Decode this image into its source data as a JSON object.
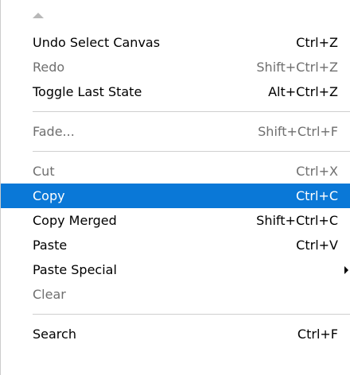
{
  "menu": {
    "group1": [
      {
        "label": "Undo Select Canvas",
        "shortcut": "Ctrl+Z"
      },
      {
        "label": "Redo",
        "shortcut": "Shift+Ctrl+Z"
      },
      {
        "label": "Toggle Last State",
        "shortcut": "Alt+Ctrl+Z"
      }
    ],
    "group2": [
      {
        "label": "Fade...",
        "shortcut": "Shift+Ctrl+F"
      }
    ],
    "group3": [
      {
        "label": "Cut",
        "shortcut": "Ctrl+X"
      },
      {
        "label": "Copy",
        "shortcut": "Ctrl+C"
      },
      {
        "label": "Copy Merged",
        "shortcut": "Shift+Ctrl+C"
      },
      {
        "label": "Paste",
        "shortcut": "Ctrl+V"
      },
      {
        "label": "Paste Special",
        "shortcut": ""
      },
      {
        "label": "Clear",
        "shortcut": ""
      }
    ],
    "group4": [
      {
        "label": "Search",
        "shortcut": "Ctrl+F"
      }
    ]
  },
  "colors": {
    "highlight": "#0a78d7",
    "disabled_text": "#6f6f6f",
    "separator": "#cfcfcf"
  }
}
